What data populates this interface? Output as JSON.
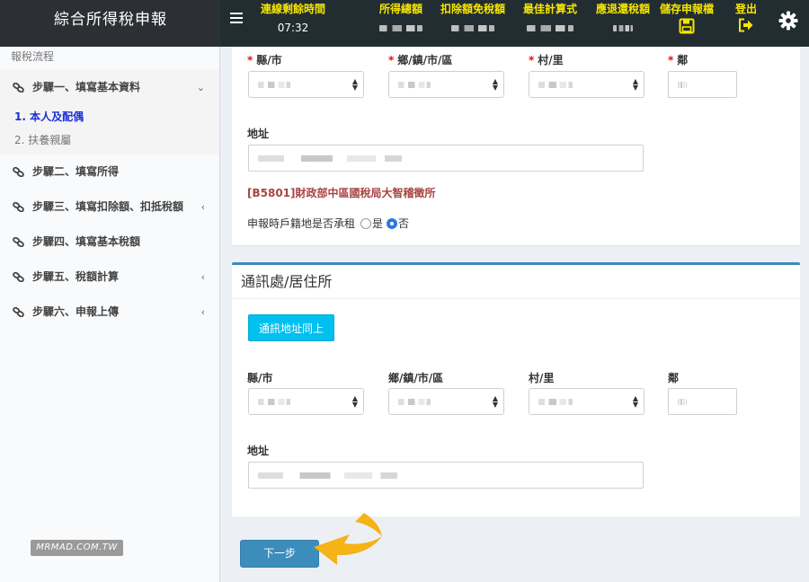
{
  "app": {
    "title": "綜合所得稅申報"
  },
  "topbar": {
    "timer_label": "連線剩餘時間",
    "timer_value": "07:32",
    "total_income_label": "所得總額",
    "deduction_label": "扣除額免稅額",
    "best_calc_label": "最佳計算式",
    "refund_label": "應退還稅額",
    "save_label": "儲存申報檔",
    "logout_label": "登出"
  },
  "sidebar": {
    "header": "報稅流程",
    "steps": [
      {
        "label": "步驟一、填寫基本資料",
        "expanded": true
      },
      {
        "label": "步驟二、填寫所得"
      },
      {
        "label": "步驟三、填寫扣除額、扣抵稅額"
      },
      {
        "label": "步驟四、填寫基本稅額"
      },
      {
        "label": "步驟五、稅額計算"
      },
      {
        "label": "步驟六、申報上傳"
      }
    ],
    "sub_items": [
      {
        "label": "1. 本人及配偶",
        "current": true
      },
      {
        "label": "2. 扶養親屬"
      }
    ]
  },
  "household": {
    "county_label": "縣/市",
    "township_label": "鄉/鎮/市/區",
    "village_label": "村/里",
    "neighborhood_label": "鄰",
    "address_label": "地址",
    "tax_office": "[B5801]財政部中區國稅局大智稽徵所",
    "rent_question": "申報時戶籍地是否承租",
    "rent_yes": "是",
    "rent_no": "否"
  },
  "mailing": {
    "title": "通訊處/居住所",
    "same_button": "通訊地址同上",
    "county_label": "縣/市",
    "township_label": "鄉/鎮/市/區",
    "village_label": "村/里",
    "neighborhood_label": "鄰",
    "address_label": "地址"
  },
  "actions": {
    "next_label": "下一步"
  },
  "watermark": "MRMAD.COM.TW",
  "colors": {
    "accent": "#3c8dbc",
    "highlight": "#f7e600",
    "pointer": "#f5b315"
  }
}
